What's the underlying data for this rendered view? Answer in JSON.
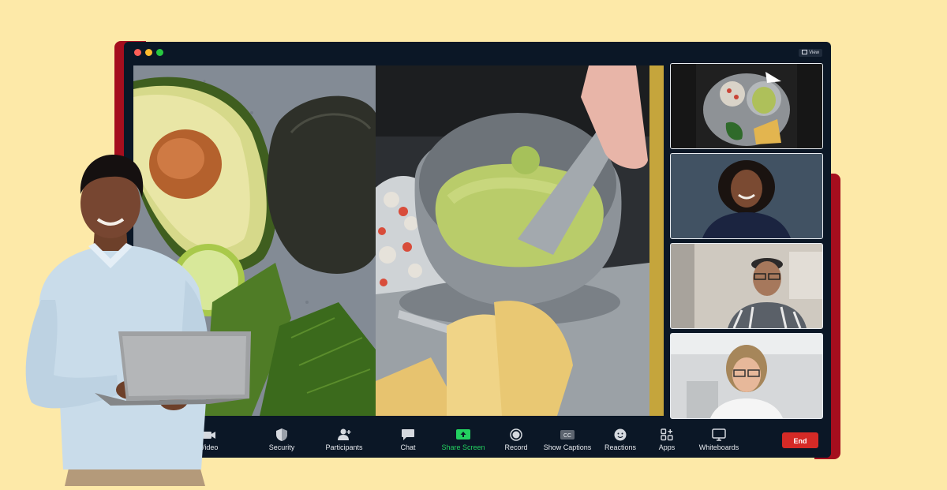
{
  "window": {
    "view_label": "View"
  },
  "toolbar": {
    "items": [
      {
        "label": "Video",
        "icon": "video-camera-icon"
      },
      {
        "label": "Security",
        "icon": "shield-icon"
      },
      {
        "label": "Participants",
        "icon": "participants-icon"
      },
      {
        "label": "Chat",
        "icon": "chat-bubble-icon"
      },
      {
        "label": "Share Screen",
        "icon": "share-screen-icon"
      },
      {
        "label": "Record",
        "icon": "record-icon"
      },
      {
        "label": "Show Captions",
        "icon": "cc-icon"
      },
      {
        "label": "Reactions",
        "icon": "smiley-icon"
      },
      {
        "label": "Apps",
        "icon": "apps-icon"
      },
      {
        "label": "Whiteboards",
        "icon": "whiteboard-icon"
      }
    ],
    "end_label": "End"
  },
  "participants": [
    {
      "tile": "food-tray-video"
    },
    {
      "tile": "woman-smiling-video"
    },
    {
      "tile": "man-glasses-video"
    },
    {
      "tile": "person-glasses-video"
    }
  ],
  "colors": {
    "background": "#fde9a8",
    "accent_red": "#a50e1e",
    "window": "#0b1726",
    "share_green": "#23d160",
    "end_red": "#d52a26",
    "gold_strip": "#c5a53c"
  }
}
